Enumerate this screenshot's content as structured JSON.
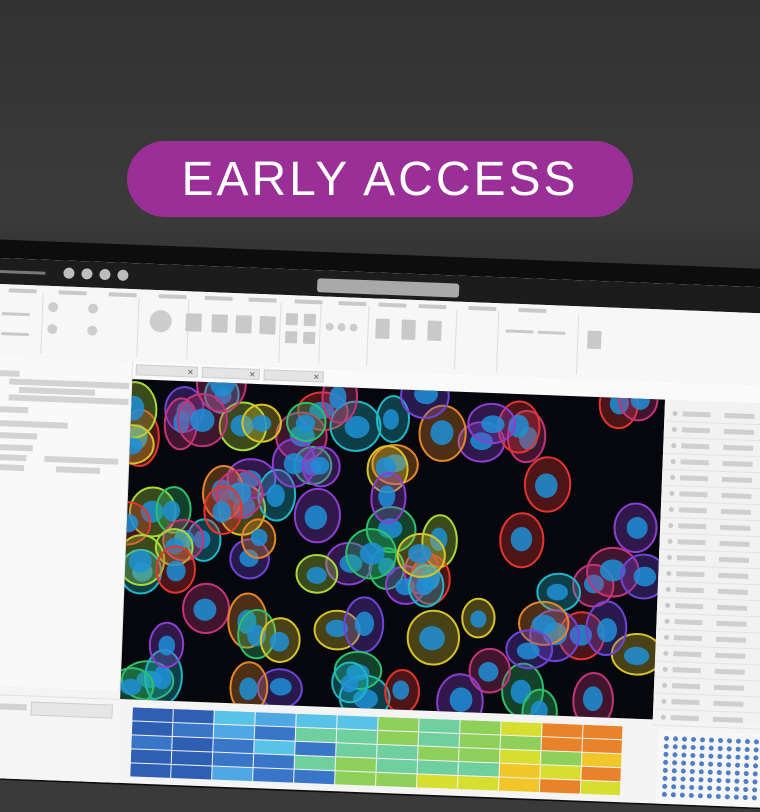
{
  "banner": {
    "label": "EARLY ACCESS",
    "color": "#9a2f97"
  },
  "screen": {
    "titlebar_icons": [
      "window-dot-icon",
      "window-dot-icon",
      "window-dot-icon",
      "window-dot-icon"
    ],
    "image_view": {
      "description_colors": {
        "background": "#06070c",
        "nucleus": "#1f8fd6",
        "outline_colors": [
          "#e2352f",
          "#8b3fd0",
          "#d6c22a",
          "#2fbf6a",
          "#1fb7c9",
          "#e3862b",
          "#6f44d8",
          "#c2347a",
          "#a8d93a"
        ]
      }
    },
    "heatmap": {
      "palette": [
        "#2f5fb3",
        "#3a76c8",
        "#4fa7e3",
        "#58c3e6",
        "#6fcf9e",
        "#8fd05a",
        "#d6df2f",
        "#f0c62a",
        "#e8832b"
      ]
    },
    "dots_color": "#4f7fc4"
  }
}
